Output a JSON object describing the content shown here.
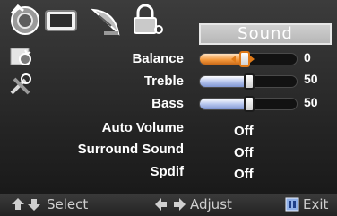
{
  "menu_title": "Sound",
  "top_icons": [
    "tv-picture-icon",
    "screen-icon",
    "satellite-dish-icon",
    "lock-icon"
  ],
  "side_icons": [
    "setup-gear-icon",
    "tools-icon"
  ],
  "items": [
    {
      "label": "Balance",
      "type": "slider",
      "value": "0",
      "level": 0.45,
      "selected": true
    },
    {
      "label": "Treble",
      "type": "slider",
      "value": "50",
      "level": 0.5,
      "selected": false
    },
    {
      "label": "Bass",
      "type": "slider",
      "value": "50",
      "level": 0.5,
      "selected": false
    },
    {
      "label": "Auto Volume",
      "type": "option",
      "value": "Off"
    },
    {
      "label": "Surround Sound",
      "type": "option",
      "value": "Off"
    },
    {
      "label": "Spdif",
      "type": "option",
      "value": "Off"
    }
  ],
  "hints": {
    "select": "Select",
    "adjust": "Adjust",
    "exit": "Exit"
  },
  "colors": {
    "accent": "#e07a18",
    "fill_blue": "#a6b8e6",
    "title_bg": "#c4c4c4"
  }
}
